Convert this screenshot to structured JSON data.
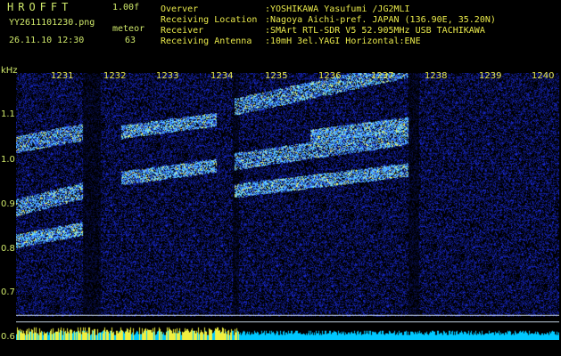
{
  "app": {
    "title": "HROFFT",
    "version": "1.00f"
  },
  "image_file": "YY2611101230.png",
  "datetime": "26.11.10 12:30",
  "meteor": {
    "label": "meteor",
    "count": "63"
  },
  "meta": [
    {
      "label": "Overver",
      "value": ":YOSHIKAWA Yasufumi /JG2MLI"
    },
    {
      "label": "Receiving Location",
      "value": ":Nagoya Aichi-pref. JAPAN (136.90E, 35.20N)"
    },
    {
      "label": "Receiver",
      "value": ":SMArt RTL-SDR V5 52.905MHz USB TACHIKAWA"
    },
    {
      "label": "Receiving Antenna",
      "value": ":10mH 3el.YAGI Horizontal:ENE"
    }
  ],
  "y_axis": {
    "unit": "kHz",
    "ticks": [
      "1.1",
      "1.0",
      "0.9",
      "0.8",
      "0.7",
      "0.6"
    ]
  },
  "x_axis": {
    "ticks": [
      "1231",
      "1232",
      "1233",
      "1234",
      "1235",
      "1236",
      "1237",
      "1238",
      "1239",
      "1240"
    ]
  },
  "colors": {
    "background": "#000000",
    "noise": "#1a2fd0",
    "signal": "#8fe0ff",
    "strong": "#f0f060",
    "baseline": "#00c8ff"
  }
}
